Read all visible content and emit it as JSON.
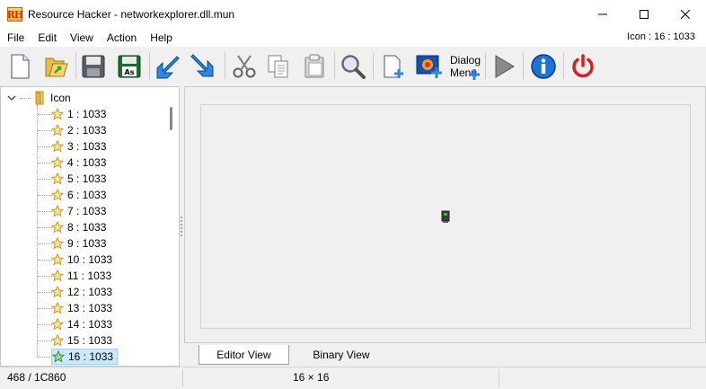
{
  "titlebar": {
    "app_icon_text": "RH",
    "title": "Resource Hacker - networkexplorer.dll.mun",
    "icons": [
      "minimize-icon",
      "maximize-icon",
      "close-icon"
    ]
  },
  "menu": {
    "items": [
      "File",
      "Edit",
      "View",
      "Action",
      "Help"
    ],
    "status": "Icon : 16 : 1033"
  },
  "toolbar": {
    "buttons": [
      {
        "icon": "new-file-icon"
      },
      {
        "icon": "open-folder-icon"
      },
      {
        "icon": "save-icon"
      },
      {
        "icon": "save-as-icon",
        "badge": "As"
      },
      {
        "icon": "arrow-import-icon"
      },
      {
        "icon": "arrow-export-icon"
      },
      {
        "icon": "cut-icon"
      },
      {
        "icon": "copy-icon"
      },
      {
        "icon": "paste-icon"
      },
      {
        "icon": "search-icon"
      },
      {
        "icon": "add-resource-icon"
      },
      {
        "icon": "add-image-icon"
      },
      {
        "icon": "dialog-menu-icon",
        "label_top": "Dialog",
        "label_bottom": "Menu"
      },
      {
        "icon": "play-icon"
      },
      {
        "icon": "info-icon"
      },
      {
        "icon": "power-icon"
      }
    ],
    "colors": {
      "accent_blue": "#1e73d2",
      "power_red": "#d42020",
      "star_gold": "#f2c23a"
    }
  },
  "tree": {
    "root_label": "Icon",
    "items": [
      "1 : 1033",
      "2 : 1033",
      "3 : 1033",
      "4 : 1033",
      "5 : 1033",
      "6 : 1033",
      "7 : 1033",
      "8 : 1033",
      "9 : 1033",
      "10 : 1033",
      "11 : 1033",
      "12 : 1033",
      "13 : 1033",
      "14 : 1033",
      "15 : 1033",
      "16 : 1033"
    ],
    "selected_index": 15
  },
  "tabs": {
    "editor": "Editor View",
    "binary": "Binary View"
  },
  "status": {
    "left": "468 / 1C860",
    "middle": "16 × 16"
  },
  "colors": {
    "selection_bg": "#cce8ff",
    "selection_border": "#99d1ff"
  }
}
